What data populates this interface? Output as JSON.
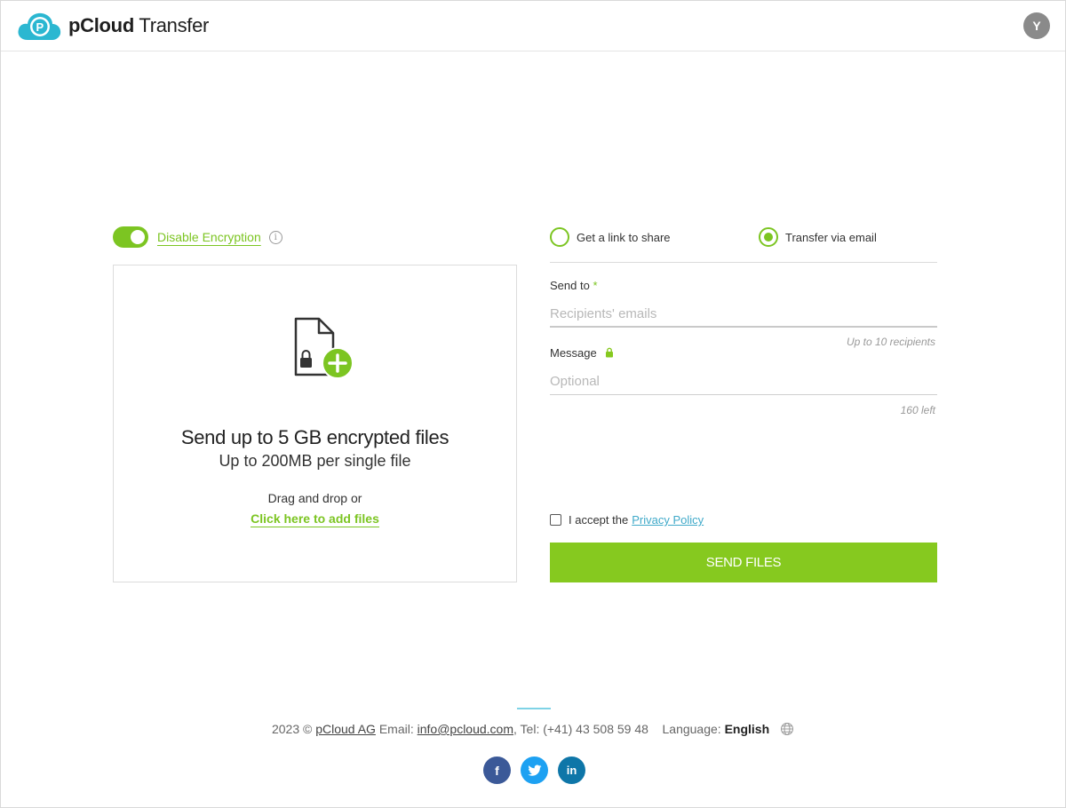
{
  "header": {
    "brand_bold": "pCloud",
    "brand_rest": " Transfer",
    "avatar_initial": "Y"
  },
  "encryption": {
    "toggle_on": true,
    "label": "Disable Encryption",
    "info_glyph": "i"
  },
  "dropzone": {
    "title": "Send up to 5 GB encrypted files",
    "subtitle": "Up to 200MB per single file",
    "drag_text": "Drag and drop or",
    "add_link": "Click here to add files"
  },
  "transfer_mode": {
    "options": [
      {
        "label": "Get a link to share",
        "selected": false
      },
      {
        "label": "Transfer via email",
        "selected": true
      }
    ]
  },
  "form": {
    "send_to_label": "Send to",
    "required_mark": "*",
    "recipients_placeholder": "Recipients' emails",
    "recipients_hint": "Up to 10 recipients",
    "message_label": "Message",
    "message_placeholder": "Optional",
    "message_hint": "160 left",
    "accept_prefix": "I accept the",
    "privacy_link": "Privacy Policy",
    "send_button": "SEND FILES"
  },
  "footer": {
    "year": "2023 ©",
    "company": "pCloud AG",
    "email_label": "Email:",
    "email": "info@pcloud.com",
    "tel": ", Tel: (+41) 43 508 59 48",
    "language_label": "Language:",
    "language": "English",
    "social": [
      "f",
      "t",
      "in"
    ]
  },
  "colors": {
    "accent": "#86c91f",
    "link": "#3fa9c9",
    "facebook": "#3b5998",
    "twitter": "#1da1f2",
    "linkedin": "#0e76a8"
  }
}
